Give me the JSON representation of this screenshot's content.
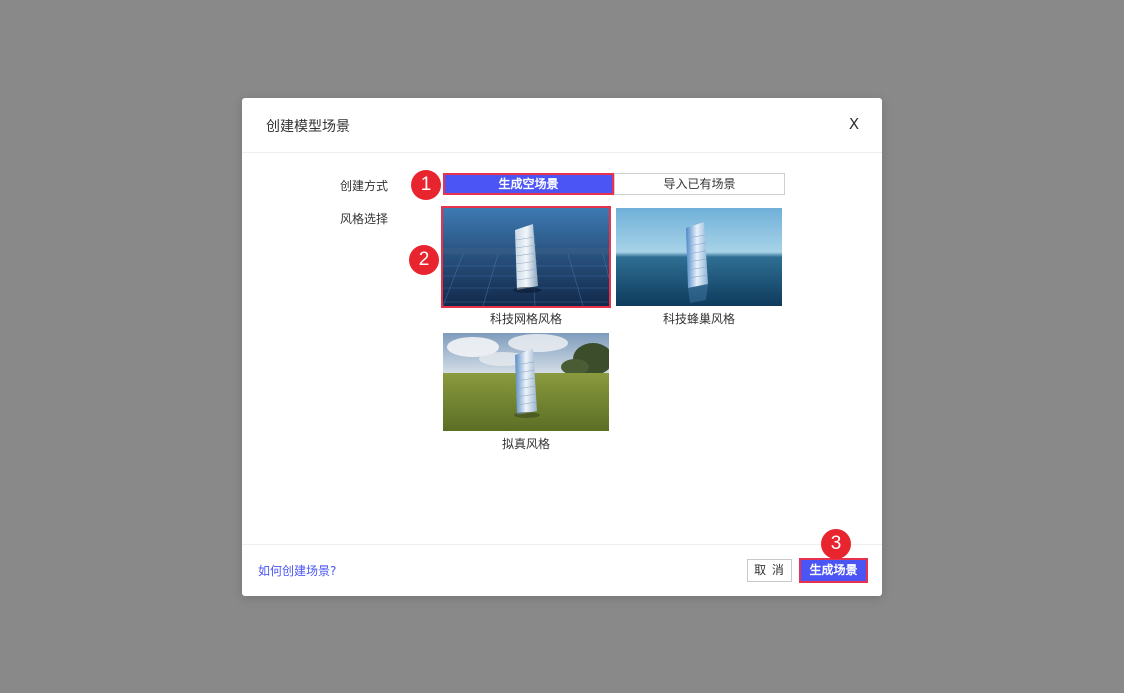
{
  "dialog": {
    "title": "创建模型场景",
    "close_label": "X"
  },
  "form": {
    "create_method_label": "创建方式",
    "style_label": "风格选择",
    "create_method_options": [
      {
        "label": "生成空场景",
        "selected": true
      },
      {
        "label": "导入已有场景",
        "selected": false
      }
    ],
    "styles": [
      {
        "label": "科技网格风格",
        "selected": true
      },
      {
        "label": "科技蜂巢风格",
        "selected": false
      },
      {
        "label": "拟真风格",
        "selected": false
      }
    ]
  },
  "footer": {
    "help_link": "如何创建场景?",
    "cancel_label": "取 消",
    "confirm_label": "生成场景"
  },
  "markers": [
    "1",
    "2",
    "3"
  ],
  "colors": {
    "overlay": "#898989",
    "primary": "#4b55f5",
    "highlight": "#e8314b",
    "marker": "#e8242f"
  }
}
